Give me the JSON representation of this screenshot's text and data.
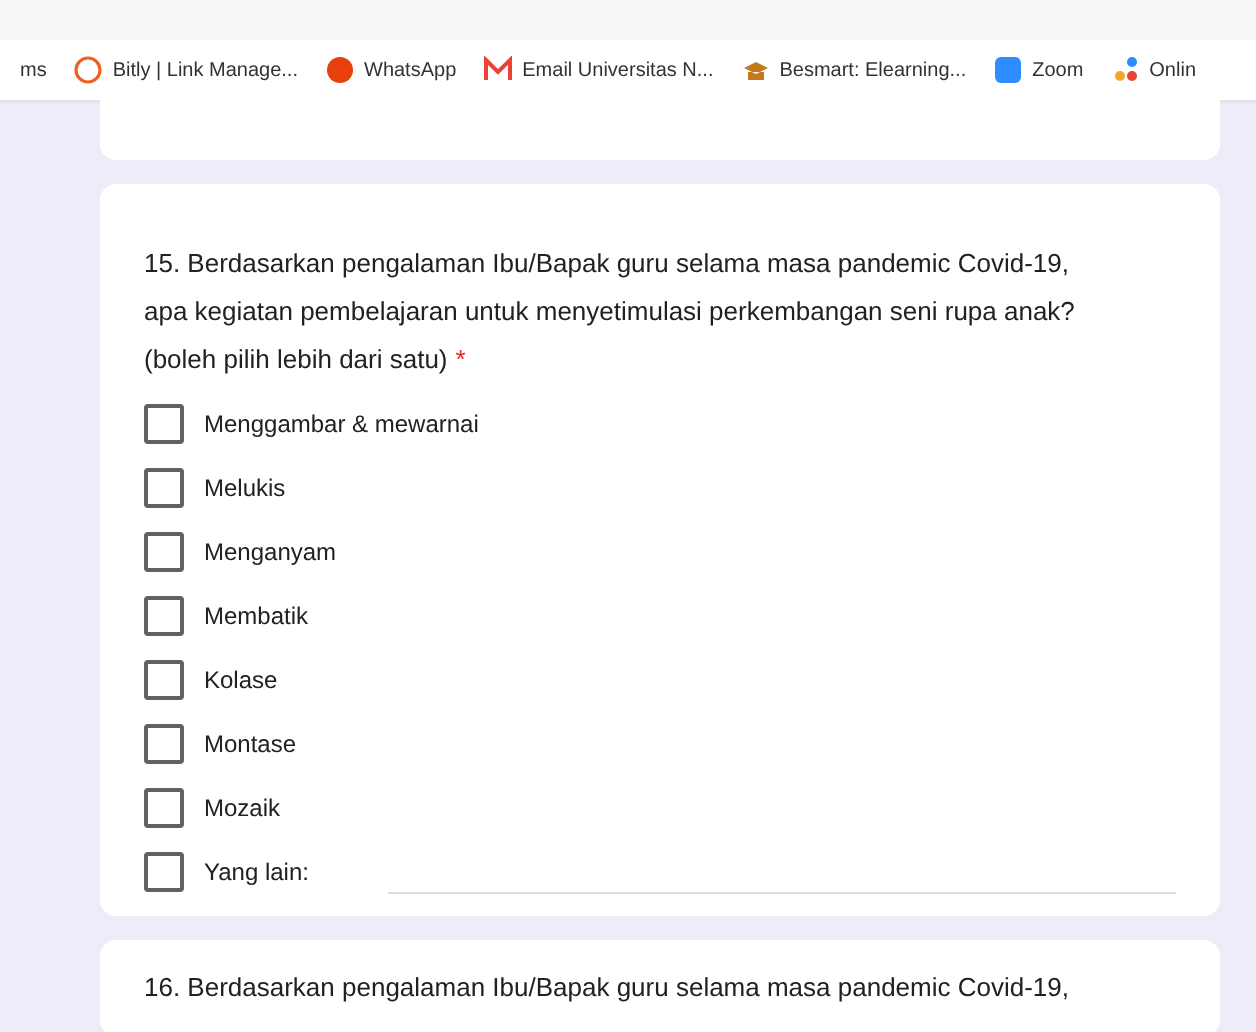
{
  "bookmarks": [
    {
      "label": "ms",
      "kind": "none"
    },
    {
      "label": "Bitly | Link Manage...",
      "kind": "bitly"
    },
    {
      "label": "WhatsApp",
      "kind": "alert"
    },
    {
      "label": "Email Universitas N...",
      "kind": "mail"
    },
    {
      "label": "Besmart: Elearning...",
      "kind": "hat"
    },
    {
      "label": "Zoom",
      "kind": "zoom"
    },
    {
      "label": "Onlin",
      "kind": "dots"
    }
  ],
  "questions": [
    {
      "text": "15. Berdasarkan pengalaman Ibu/Bapak guru selama masa pandemic Covid-19, apa kegiatan pembelajaran untuk menyetimulasi perkembangan seni rupa anak? (boleh pilih lebih dari satu)",
      "required_mark": "*",
      "options": [
        {
          "label": "Menggambar & mewarnai",
          "checked": false,
          "kind": "plain"
        },
        {
          "label": "Melukis",
          "checked": false,
          "kind": "plain"
        },
        {
          "label": "Menganyam",
          "checked": false,
          "kind": "plain"
        },
        {
          "label": "Membatik",
          "checked": false,
          "kind": "plain"
        },
        {
          "label": "Kolase",
          "checked": false,
          "kind": "plain"
        },
        {
          "label": "Montase",
          "checked": false,
          "kind": "plain"
        },
        {
          "label": "Mozaik",
          "checked": false,
          "kind": "plain"
        },
        {
          "label": "Yang lain:",
          "checked": false,
          "kind": "other"
        }
      ]
    },
    {
      "text": "16. Berdasarkan pengalaman Ibu/Bapak guru selama masa pandemic Covid-19,"
    }
  ]
}
